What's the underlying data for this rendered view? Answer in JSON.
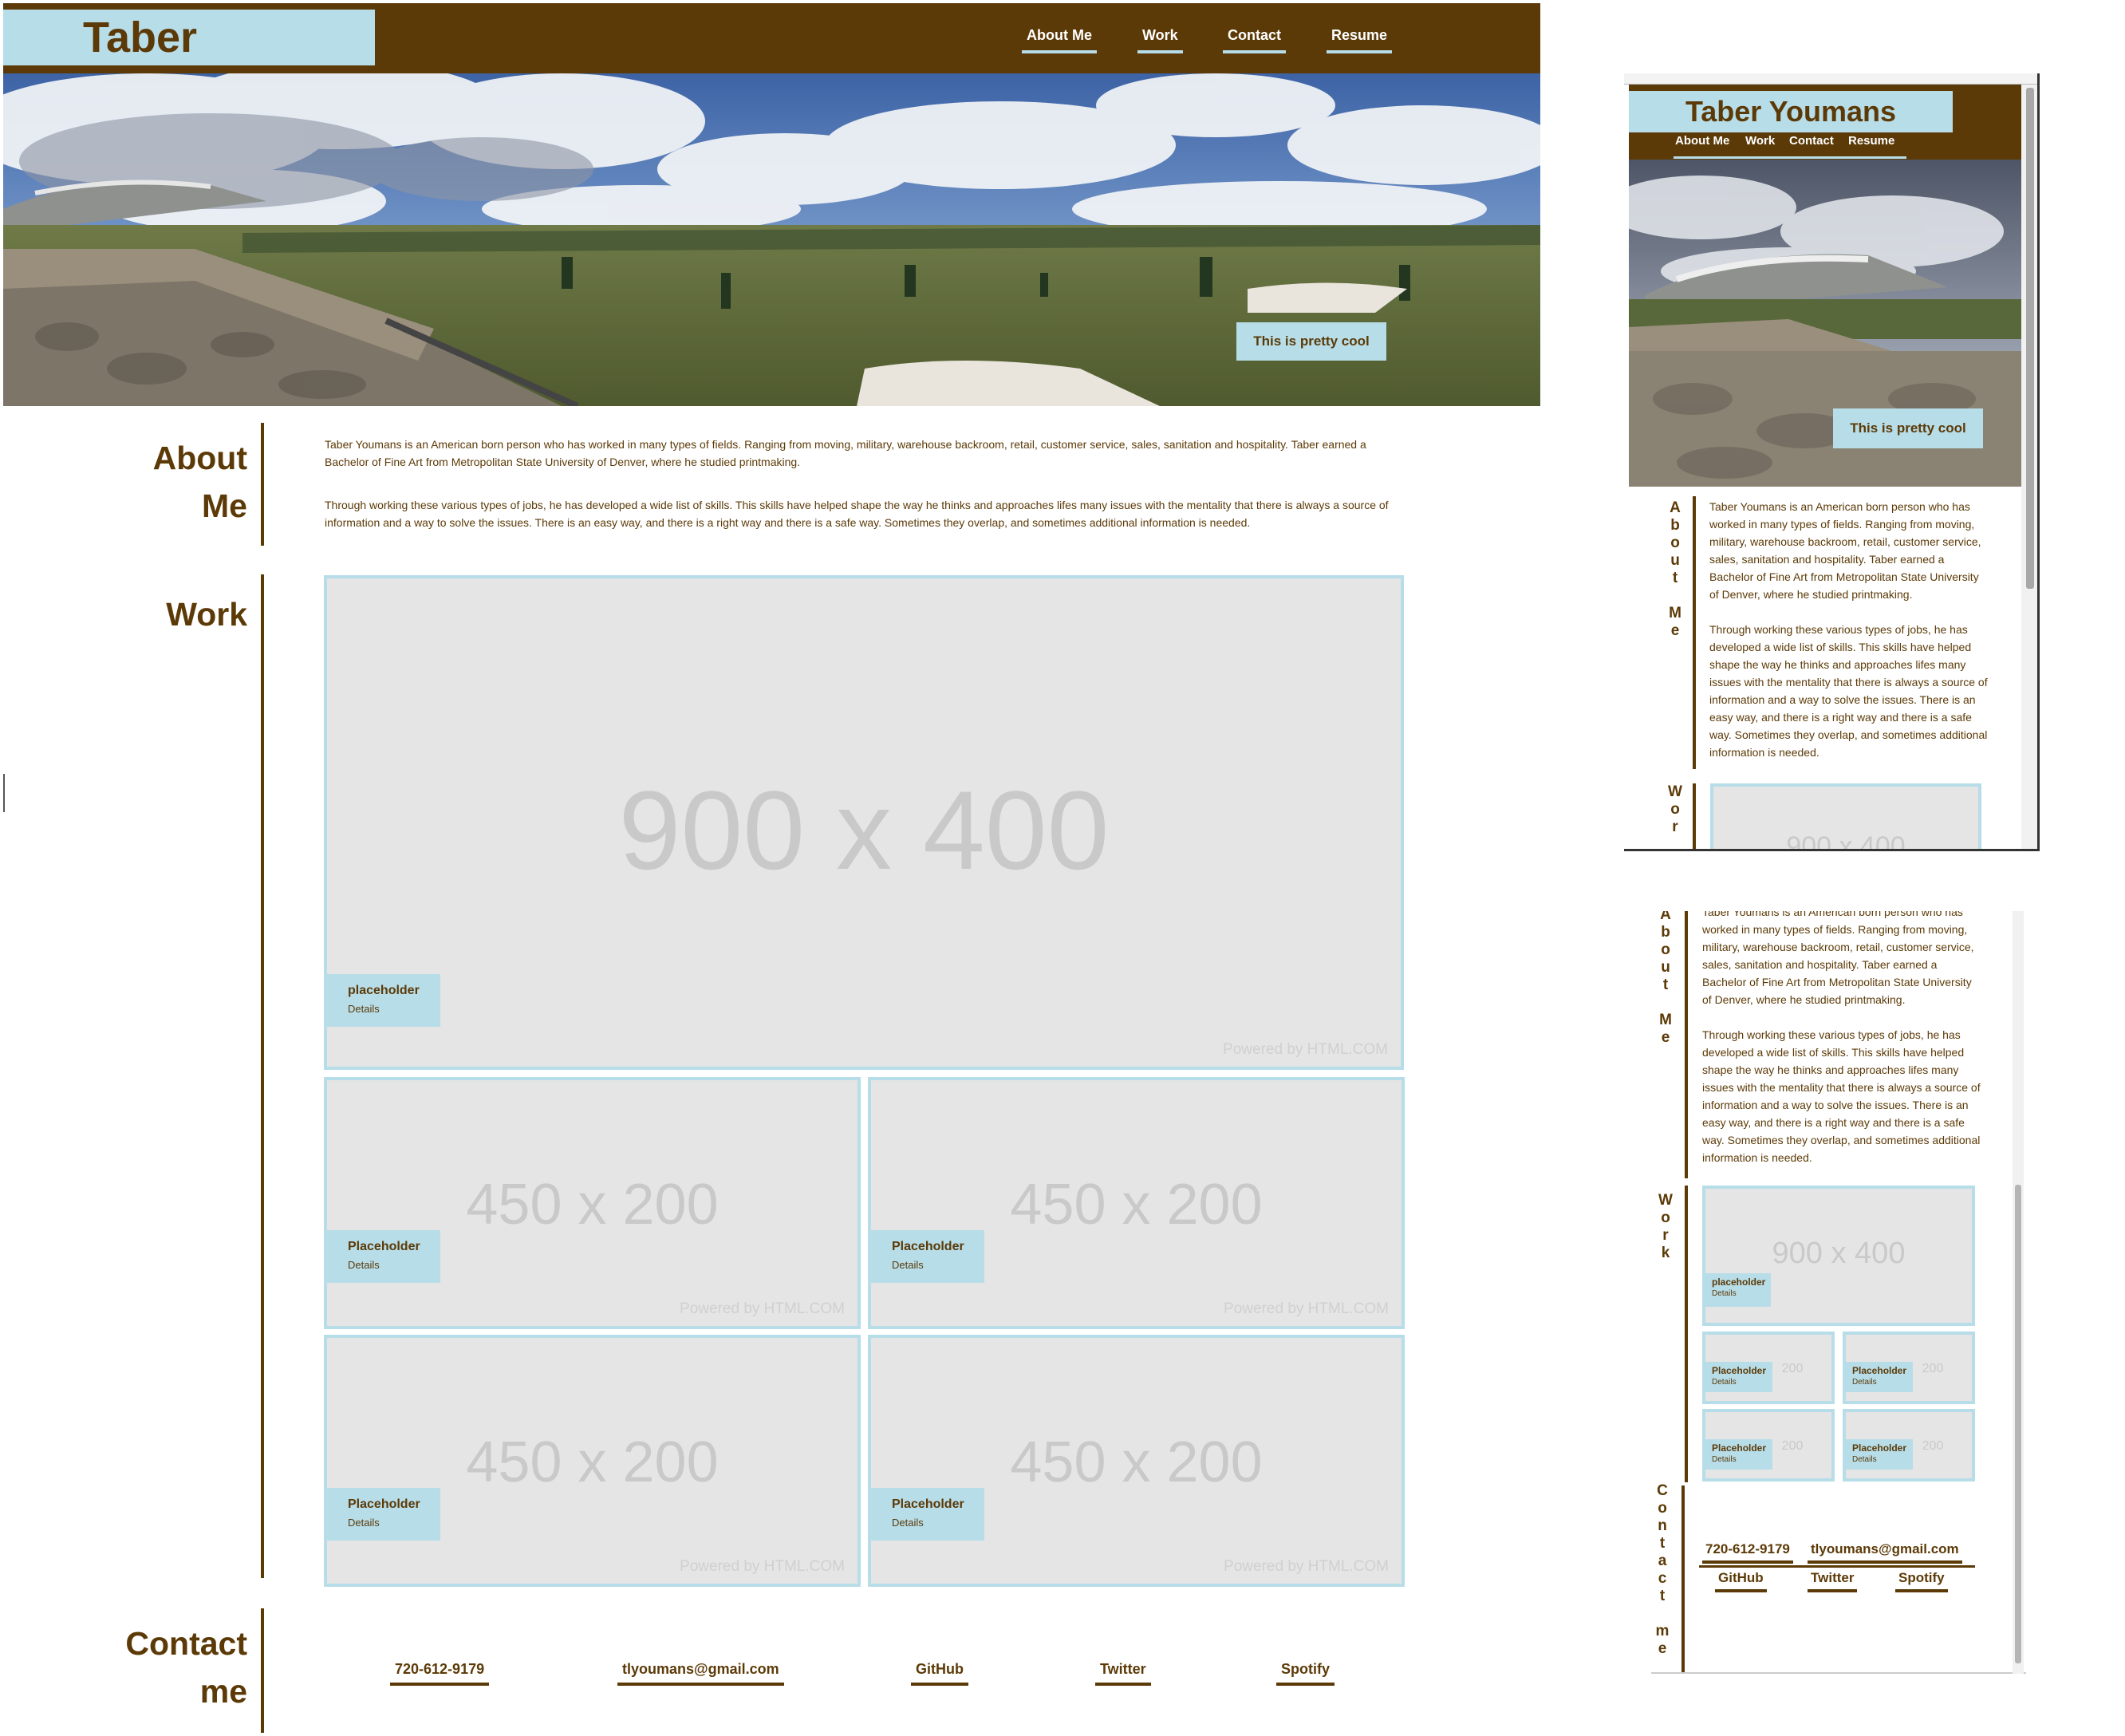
{
  "site": {
    "title": "Taber Youmans",
    "nav": [
      "About Me",
      "Work",
      "Contact",
      "Resume"
    ],
    "hero_caption": "This is pretty cool"
  },
  "about": {
    "heading_line1": "About",
    "heading_line2": "Me",
    "vertical_heading": [
      "A",
      "b",
      "o",
      "u",
      "t",
      "",
      "M",
      "e"
    ],
    "para1": "Taber Youmans is an American born person who has worked in many types of fields. Ranging from moving, military, warehouse backroom, retail, customer service, sales, sanitation and hospitality. Taber earned a Bachelor of Fine Art from Metropolitan State University of Denver, where he studied printmaking.",
    "para2": "Through working these various types of jobs, he has developed a wide list of skills. This skills have helped shape the way he thinks and approaches lifes many issues with the mentality that there is always a source of information and a way to solve the issues. There is an easy way, and there is a right way and there is a safe way. Sometimes they overlap, and sometimes additional information is needed."
  },
  "work": {
    "heading": "Work",
    "vertical_heading": [
      "W",
      "o",
      "r",
      "k"
    ],
    "featured": {
      "size_label": "900 x 400",
      "title": "placeholder",
      "details": "Details",
      "powered": "Powered by HTML.COM"
    },
    "items": [
      {
        "size_label": "450 x 200",
        "title": "Placeholder",
        "details": "Details",
        "powered": "Powered by HTML.COM"
      },
      {
        "size_label": "450 x 200",
        "title": "Placeholder",
        "details": "Details",
        "powered": "Powered by HTML.COM"
      },
      {
        "size_label": "450 x 200",
        "title": "Placeholder",
        "details": "Details",
        "powered": "Powered by HTML.COM"
      },
      {
        "size_label": "450 x 200",
        "title": "Placeholder",
        "details": "Details",
        "powered": "Powered by HTML.COM"
      }
    ],
    "small_size_label": "200",
    "mobile_partial_label": "900 x 400"
  },
  "contact": {
    "heading_line1": "Contact",
    "heading_line2": "me",
    "vertical_heading": [
      "C",
      "o",
      "n",
      "t",
      "a",
      "c",
      "t",
      "",
      "m",
      "e"
    ],
    "phone": "720-612-9179",
    "email": "tlyoumans@gmail.com",
    "links": [
      "GitHub",
      "Twitter",
      "Spotify"
    ]
  },
  "colors": {
    "brown": "#5c3a07",
    "light_blue": "#b7dde9",
    "placeholder_gray": "#e5e5e5"
  },
  "icons": [
    "landscape-photo",
    "vertical-scrollbar"
  ]
}
